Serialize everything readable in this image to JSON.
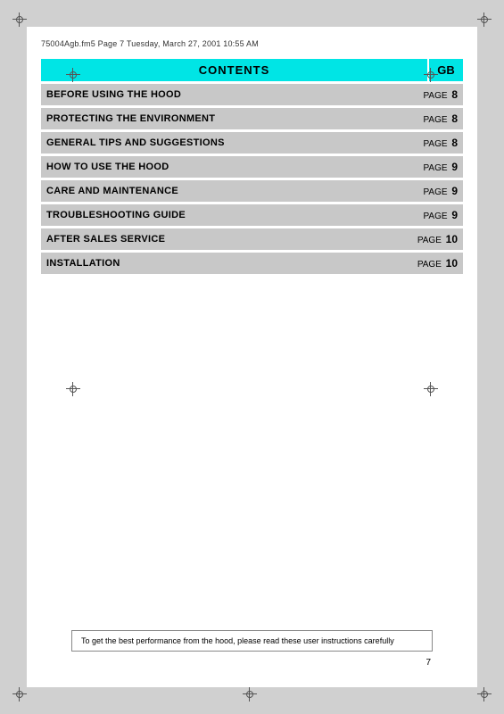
{
  "header": {
    "file_info": "75004Agb.fm5  Page 7  Tuesday, March 27, 2001  10:55 AM"
  },
  "contents": {
    "title": "CONTENTS",
    "gb_label": "GB",
    "rows": [
      {
        "label": "BEFORE USING THE HOOD",
        "page_text": "PAGE",
        "page_num": "8"
      },
      {
        "label": "PROTECTING THE ENVIRONMENT",
        "page_text": "PAGE",
        "page_num": "8"
      },
      {
        "label": "GENERAL TIPS AND SUGGESTIONS",
        "page_text": "PAGE",
        "page_num": "8"
      },
      {
        "label": "HOW TO USE THE HOOD",
        "page_text": "PAGE",
        "page_num": "9"
      },
      {
        "label": "CARE AND MAINTENANCE",
        "page_text": "PAGE",
        "page_num": "9"
      },
      {
        "label": "TROUBLESHOOTING GUIDE",
        "page_text": "PAGE",
        "page_num": "9"
      },
      {
        "label": "AFTER SALES SERVICE",
        "page_text": "PAGE",
        "page_num": "10"
      },
      {
        "label": "INSTALLATION",
        "page_text": "PAGE",
        "page_num": "10"
      }
    ]
  },
  "footer": {
    "text": "To get the best performance from the hood, please read these user instructions carefully"
  },
  "page_number": "7"
}
